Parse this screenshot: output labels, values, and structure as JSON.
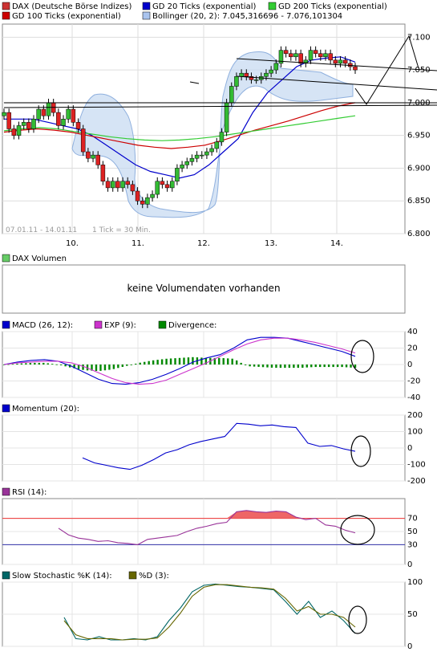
{
  "legend_main": [
    {
      "label": "DAX (Deutsche Börse Indizes)",
      "color": "#cc3333"
    },
    {
      "label": "GD 20 Ticks (exponential)",
      "color": "#0000cc"
    },
    {
      "label": "GD 200 Ticks (exponential)",
      "color": "#33cc33"
    },
    {
      "label": "GD 100 Ticks (exponential)",
      "color": "#cc0000"
    },
    {
      "label": "Bollinger (20, 2): 7.045,316696 - 7.076,101304",
      "color": "#aac4ee"
    }
  ],
  "date_range": "07.01.11 - 14.01.11",
  "tick_note": "1 Tick = 30 Min.",
  "volume": {
    "label": "DAX Volumen",
    "color": "#66cc66",
    "message": "keine Volumendaten vorhanden"
  },
  "macd_legend": [
    {
      "label": "MACD (26, 12):",
      "color": "#0000cc"
    },
    {
      "label": "EXP (9):",
      "color": "#cc33cc"
    },
    {
      "label": "Divergence:",
      "color": "#008800"
    }
  ],
  "momentum_legend": {
    "label": "Momentum (20):",
    "color": "#0000cc"
  },
  "rsi_legend": {
    "label": "RSI (14):",
    "color": "#993399"
  },
  "stoch_legend": [
    {
      "label": "Slow Stochastic %K (14):",
      "color": "#006666"
    },
    {
      "label": "%D (3):",
      "color": "#666600"
    }
  ],
  "chart_data": [
    {
      "type": "candlestick",
      "title": "DAX (Deutsche Börse Indizes)",
      "x_labels": [
        "10.",
        "11.",
        "12.",
        "13.",
        "14."
      ],
      "y_ticks": [
        "7.100",
        "7.050",
        "7.000",
        "6.950",
        "6.900",
        "6.850",
        "6.800"
      ],
      "ylim": [
        6800,
        7120
      ],
      "close": [
        6985,
        6960,
        6950,
        6965,
        6970,
        6960,
        6975,
        6990,
        6980,
        7000,
        6985,
        6965,
        6975,
        6990,
        6970,
        6960,
        6925,
        6915,
        6920,
        6905,
        6880,
        6870,
        6880,
        6870,
        6880,
        6875,
        6865,
        6850,
        6845,
        6855,
        6860,
        6880,
        6875,
        6870,
        6880,
        6900,
        6905,
        6910,
        6915,
        6920,
        6920,
        6925,
        6930,
        6940,
        6955,
        7000,
        7025,
        7040,
        7045,
        7040,
        7035,
        7035,
        7040,
        7045,
        7050,
        7060,
        7080,
        7075,
        7070,
        7075,
        7060,
        7065,
        7080,
        7075,
        7070,
        7075,
        7065,
        7060,
        7065,
        7060,
        7055,
        7050
      ],
      "series": [
        {
          "name": "GD 20 Ticks (exponential)",
          "values": [
            6975,
            6975,
            6975,
            6970,
            6965,
            6960,
            6950,
            6935,
            6920,
            6905,
            6895,
            6890,
            6885,
            6890,
            6905,
            6925,
            6945,
            6985,
            7015,
            7035,
            7055,
            7065,
            7068,
            7070,
            7062
          ]
        },
        {
          "name": "GD 100 Ticks (exponential)",
          "values": [
            6955,
            6958,
            6960,
            6958,
            6955,
            6950,
            6945,
            6940,
            6935,
            6932,
            6930,
            6932,
            6935,
            6942,
            6950,
            6958,
            6965,
            6972,
            6980,
            6988,
            6995,
            7000
          ]
        },
        {
          "name": "GD 200 Ticks (exponential)",
          "values": [
            6957,
            6960,
            6962,
            6960,
            6956,
            6952,
            6948,
            6945,
            6943,
            6942,
            6943,
            6945,
            6948,
            6952,
            6956,
            6960,
            6964,
            6968,
            6972,
            6976,
            6980
          ]
        }
      ],
      "bollinger_label": "Bollinger (20, 2): 7.045,316696 - 7.076,101304"
    },
    {
      "type": "bar",
      "title": "DAX Volumen",
      "note": "keine Volumendaten vorhanden"
    },
    {
      "type": "line",
      "title": "MACD (26, 12)",
      "y_ticks": [
        "40",
        "20",
        "0",
        "-20",
        "-40"
      ],
      "ylim": [
        -40,
        40
      ],
      "series": [
        {
          "name": "MACD (26, 12)",
          "values": [
            0,
            3,
            5,
            6,
            4,
            -2,
            -10,
            -18,
            -23,
            -24,
            -22,
            -18,
            -12,
            -5,
            3,
            8,
            12,
            20,
            30,
            33,
            33,
            32,
            28,
            24,
            20,
            16,
            10
          ]
        },
        {
          "name": "EXP (9)",
          "values": [
            0,
            2,
            3,
            4,
            4,
            2,
            -3,
            -10,
            -17,
            -22,
            -24,
            -23,
            -19,
            -12,
            -5,
            2,
            10,
            18,
            25,
            30,
            32,
            32,
            30,
            27,
            23,
            19,
            14
          ]
        }
      ],
      "divergence": [
        0,
        1,
        2,
        2,
        0,
        -4,
        -7,
        -8,
        -6,
        -2,
        2,
        5,
        7,
        8,
        9,
        8,
        8,
        7,
        -2,
        -3,
        -4,
        -4,
        -4,
        -3,
        -3,
        -3,
        -4
      ]
    },
    {
      "type": "line",
      "title": "Momentum (20)",
      "y_ticks": [
        "200",
        "100",
        "0",
        "-100",
        "-200"
      ],
      "ylim": [
        -200,
        200
      ],
      "series": [
        {
          "name": "Momentum (20)",
          "values": [
            -60,
            -90,
            -105,
            -120,
            -130,
            -105,
            -70,
            -30,
            -10,
            20,
            40,
            55,
            70,
            150,
            145,
            135,
            140,
            130,
            125,
            30,
            10,
            15,
            -5,
            -20
          ]
        }
      ]
    },
    {
      "type": "line",
      "title": "RSI (14)",
      "y_ticks": [
        "70",
        "50",
        "30",
        "0"
      ],
      "ylim": [
        0,
        100
      ],
      "levels": [
        70,
        30
      ],
      "series": [
        {
          "name": "RSI (14)",
          "values": [
            55,
            45,
            40,
            38,
            35,
            36,
            33,
            32,
            30,
            38,
            40,
            42,
            44,
            50,
            55,
            58,
            62,
            64,
            80,
            82,
            80,
            79,
            81,
            80,
            72,
            68,
            70,
            60,
            58,
            52,
            48
          ]
        }
      ]
    },
    {
      "type": "line",
      "title": "Slow Stochastic %K (14)",
      "y_ticks": [
        "100",
        "50",
        "0"
      ],
      "ylim": [
        0,
        100
      ],
      "series": [
        {
          "name": "Slow Stochastic %K (14)",
          "values": [
            45,
            12,
            10,
            15,
            10,
            10,
            12,
            10,
            15,
            40,
            60,
            85,
            95,
            97,
            95,
            93,
            92,
            90,
            88,
            70,
            50,
            70,
            45,
            55,
            40,
            20
          ]
        },
        {
          "name": "%D (3)",
          "values": [
            40,
            18,
            12,
            12,
            12,
            10,
            11,
            11,
            13,
            30,
            52,
            78,
            92,
            96,
            96,
            94,
            92,
            91,
            89,
            75,
            55,
            62,
            50,
            50,
            45,
            30
          ]
        }
      ]
    }
  ]
}
